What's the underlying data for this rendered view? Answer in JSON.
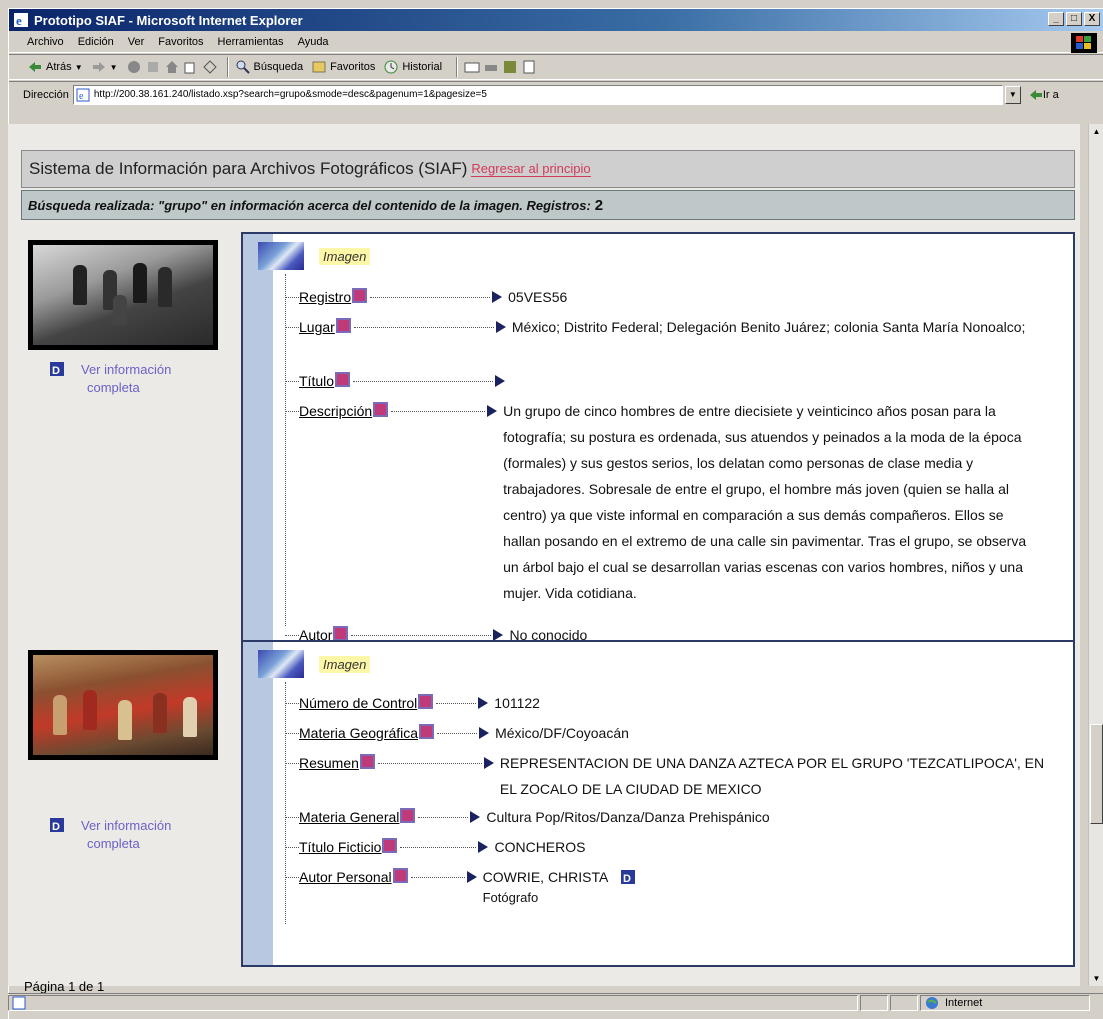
{
  "window": {
    "title": "Prototipo SIAF - Microsoft Internet Explorer",
    "buttons": [
      "_",
      "□",
      "X"
    ]
  },
  "menu": [
    "Archivo",
    "Edición",
    "Ver",
    "Favoritos",
    "Herramientas",
    "Ayuda"
  ],
  "toolbar": {
    "back": "Atrás",
    "search": "Búsqueda",
    "favorites": "Favoritos",
    "history": "Historial"
  },
  "address": {
    "label": "Dirección",
    "url": "http://200.38.161.240/listado.xsp?search=grupo&smode=desc&pagenum=1&pagesize=5",
    "go": "Ir a"
  },
  "page": {
    "title": "Sistema de Información para Archivos Fotográficos (SIAF)",
    "back_link": "Regresar al principio",
    "search_summary": "Búsqueda realizada: \"grupo\" en información acerca del contenido de la imagen. Registros:",
    "record_count": "2",
    "full_info_line1": "Ver información",
    "full_info_line2": "completa",
    "pagination": "Página 1 de 1"
  },
  "records": [
    {
      "type_label": "Imagen",
      "fields": [
        {
          "label": "Registro",
          "value": "05VES56"
        },
        {
          "label": "Lugar",
          "value": "México; Distrito Federal; Delegación Benito Juárez; colonia Santa María Nonoalco;"
        },
        {
          "label": "Título",
          "value": ""
        },
        {
          "label": "Descripción",
          "value": "Un grupo de cinco hombres de entre diecisiete y veinticinco años posan para la fotografía; su postura es ordenada, sus atuendos y peinados a la moda de la época (formales) y sus gestos serios, los delatan como personas de clase media y trabajadores. Sobresale de entre el grupo, el hombre más joven (quien se halla al centro) ya que viste informal en comparación a sus demás compañeros. Ellos se hallan posando en el extremo de una calle sin pavimentar. Tras el grupo, se observa un árbol bajo el cual se desarrollan varias escenas con varios hombres, niños y una mujer. Vida cotidiana."
        },
        {
          "label": "Autor",
          "value": "No conocido"
        }
      ]
    },
    {
      "type_label": "Imagen",
      "fields": [
        {
          "label": "Número de Control",
          "value": "101122"
        },
        {
          "label": "Materia Geográfica",
          "value": "México/DF/Coyoacán"
        },
        {
          "label": "Resumen",
          "value": "REPRESENTACION DE UNA DANZA AZTECA POR EL GRUPO 'TEZCATLIPOCA', EN EL ZOCALO DE LA CIUDAD DE MEXICO"
        },
        {
          "label": "Materia General",
          "value": "Cultura Pop/Ritos/Danza/Danza Prehispánico"
        },
        {
          "label": "Título Ficticio",
          "value": "CONCHEROS"
        },
        {
          "label": "Autor Personal",
          "value": "COWRIE, CHRISTA",
          "sub": "Fotógrafo"
        }
      ]
    }
  ],
  "status": {
    "zone": "Internet"
  }
}
